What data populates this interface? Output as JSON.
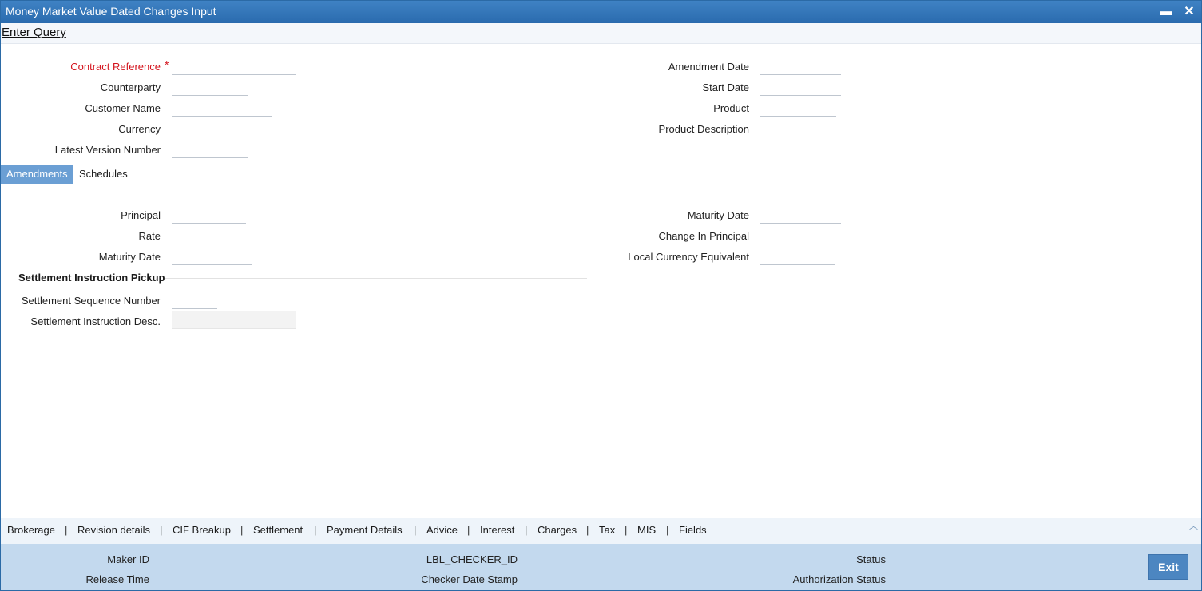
{
  "window": {
    "title": "Money Market Value Dated Changes Input",
    "minimize": "▬",
    "close": "✕"
  },
  "menu": {
    "enter_query": "Enter Query"
  },
  "header_left": {
    "contract_reference": "Contract Reference",
    "required_mark": "*",
    "counterparty": "Counterparty",
    "customer_name": "Customer Name",
    "currency": "Currency",
    "latest_version_number": "Latest Version Number"
  },
  "header_right": {
    "amendment_date": "Amendment Date",
    "start_date": "Start Date",
    "product": "Product",
    "product_description": "Product Description"
  },
  "tabs": {
    "amendments": "Amendments",
    "schedules": "Schedules"
  },
  "amendments": {
    "principal": "Principal",
    "rate": "Rate",
    "maturity_date_left": "Maturity Date",
    "maturity_date_right": "Maturity Date",
    "change_in_principal": "Change In Principal",
    "local_currency_equivalent": "Local Currency Equivalent"
  },
  "settlement": {
    "section_title": "Settlement Instruction Pickup",
    "sequence_number": "Settlement Sequence Number",
    "instruction_desc": "Settlement Instruction Desc."
  },
  "bottom_links": [
    "Brokerage",
    "Revision details",
    "CIF Breakup",
    "Settlement",
    "Payment Details",
    "Advice",
    "Interest",
    "Charges",
    "Tax",
    "MIS",
    "Fields"
  ],
  "footer": {
    "maker_id": "Maker ID",
    "release_time": "Release Time",
    "checker_id": "LBL_CHECKER_ID",
    "checker_date_stamp": "Checker Date Stamp",
    "status": "Status",
    "authorization_status": "Authorization Status",
    "exit": "Exit"
  },
  "colors": {
    "title_bar": "#2f72b6",
    "active_tab": "#6b9fd4",
    "required_label": "#d4141e",
    "footer_bg": "#c3d9ee",
    "exit_button": "#4c86c1"
  }
}
